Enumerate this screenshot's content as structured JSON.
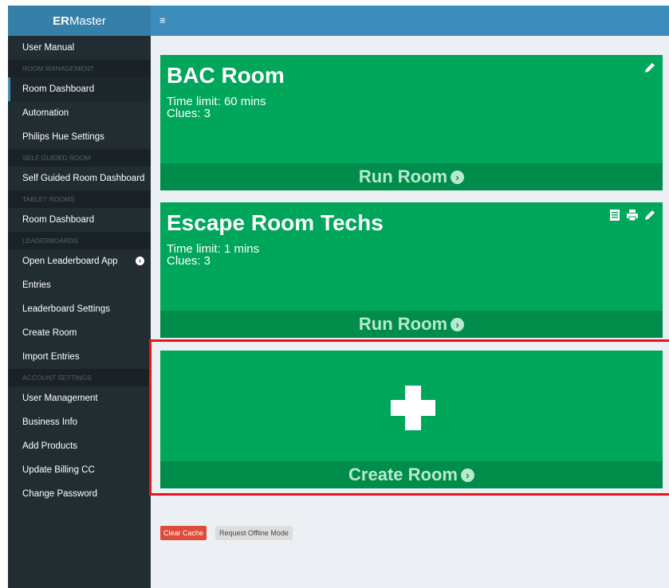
{
  "brand": {
    "bold": "ER",
    "rest": "Master"
  },
  "sidebar": {
    "user_manual": "User Manual",
    "room_management_header": "ROOM MANAGEMENT",
    "room_dashboard": "Room Dashboard",
    "automation": "Automation",
    "philips_hue": "Philips Hue Settings",
    "self_guided_header": "SELF GUIDED ROOM",
    "self_guided_dashboard": "Self Guided Room Dashboard",
    "tablet_header": "TABLET ROOMS",
    "tablet_dashboard": "Room Dashboard",
    "leaderboards_header": "LEADERBOARDS",
    "open_leaderboard": "Open Leaderboard App",
    "entries": "Entries",
    "leaderboard_settings": "Leaderboard Settings",
    "create_room": "Create Room",
    "import_entries": "Import Entries",
    "account_header": "ACCOUNT SETTINGS",
    "user_management": "User Management",
    "business_info": "Business Info",
    "add_products": "Add Products",
    "update_billing": "Update Billing CC",
    "change_password": "Change Password"
  },
  "topbar": {
    "menu_icon": "≡"
  },
  "cards": [
    {
      "title": "BAC Room",
      "time_limit": "Time limit: 60 mins",
      "clues": "Clues: 3",
      "run": "Run Room"
    },
    {
      "title": "Escape Room Techs",
      "time_limit": "Time limit: 1 mins",
      "clues": "Clues: 3",
      "run": "Run Room"
    }
  ],
  "create_card": {
    "label": "Create Room"
  },
  "buttons": {
    "clear_cache": "Clear Cache",
    "offline": "Request Offline Mode"
  },
  "colors": {
    "green": "#00a65a",
    "dark_green": "#008d4c",
    "sidebar": "#222d32",
    "header": "#3c8dbc",
    "highlight": "#e8131b"
  }
}
